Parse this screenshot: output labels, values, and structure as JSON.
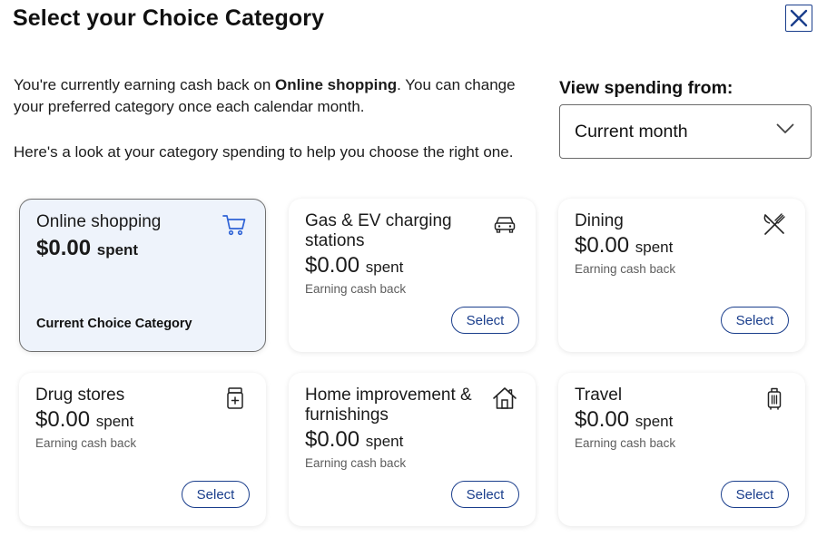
{
  "modal": {
    "title": "Select your Choice Category",
    "close_icon": "close-icon"
  },
  "intro": {
    "text_before": "You're currently earning cash back on ",
    "current_category": "Online shopping",
    "text_after": ". You can change your preferred category once each calendar month.",
    "hint": "Here's a look at your category spending to help you choose the right one."
  },
  "view_spending": {
    "label": "View spending from:",
    "selected": "Current month"
  },
  "cards": [
    {
      "name": "Online shopping",
      "amount": "$0.00",
      "spent": "spent",
      "status": "Current Choice Category",
      "icon": "shopping-cart-icon"
    },
    {
      "name": "Gas & EV charging stations",
      "amount": "$0.00",
      "spent": "spent",
      "note": "Earning cash back",
      "button": "Select",
      "icon": "car-icon"
    },
    {
      "name": "Dining",
      "amount": "$0.00",
      "spent": "spent",
      "note": "Earning cash back",
      "button": "Select",
      "icon": "fork-knife-icon"
    },
    {
      "name": "Drug stores",
      "amount": "$0.00",
      "spent": "spent",
      "note": "Earning cash back",
      "button": "Select",
      "icon": "pill-bottle-icon"
    },
    {
      "name": "Home improvement & furnishings",
      "amount": "$0.00",
      "spent": "spent",
      "note": "Earning cash back",
      "button": "Select",
      "icon": "house-icon"
    },
    {
      "name": "Travel",
      "amount": "$0.00",
      "spent": "spent",
      "note": "Earning cash back",
      "button": "Select",
      "icon": "luggage-icon"
    }
  ],
  "colors": {
    "accent": "#1a3e8c",
    "current_card_bg": "#eef3fb",
    "icon_blue": "#2f63d6"
  }
}
